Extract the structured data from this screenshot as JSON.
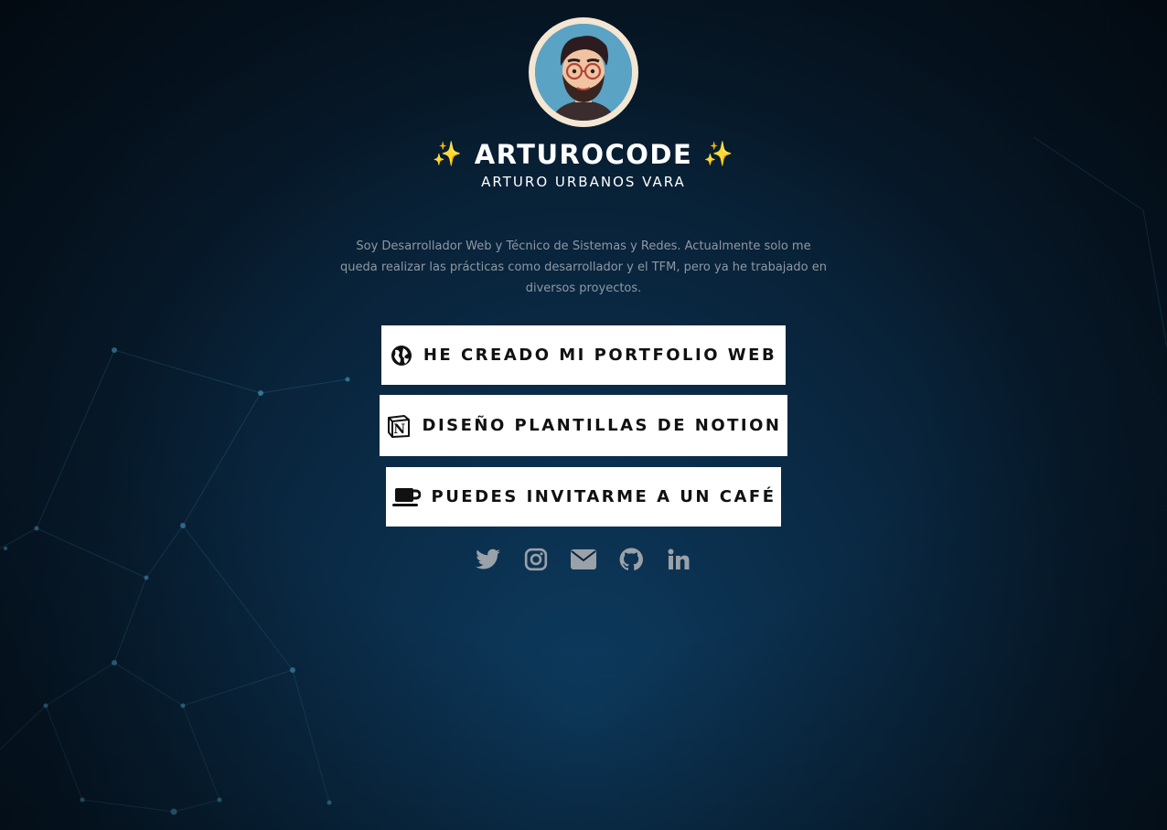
{
  "profile": {
    "avatar_alt": "Arturo avatar",
    "handle": "ARTUROCODE",
    "sparkle": "✨",
    "name": "ARTURO URBANOS VARA",
    "bio": "Soy Desarrollador Web y Técnico de Sistemas y Redes. Actualmente solo me queda realizar las prácticas como desarrollador y el TFM, pero ya he trabajado en diversos proyectos."
  },
  "links": [
    {
      "label": "HE CREADO MI PORTFOLIO WEB",
      "icon": "globe-icon"
    },
    {
      "label": "DISEÑO PLANTILLAS DE NOTION",
      "icon": "notion-icon"
    },
    {
      "label": "PUEDES INVITARME A UN CAFÉ",
      "icon": "coffee-icon"
    }
  ],
  "socials": [
    {
      "icon": "twitter-icon"
    },
    {
      "icon": "instagram-icon"
    },
    {
      "icon": "email-icon"
    },
    {
      "icon": "github-icon"
    },
    {
      "icon": "linkedin-icon"
    }
  ],
  "colors": {
    "background": "#071b2d",
    "button_bg": "#ffffff",
    "button_text": "#111111",
    "bio_text": "#8f98a2",
    "social_icon": "#9aa1a8"
  }
}
